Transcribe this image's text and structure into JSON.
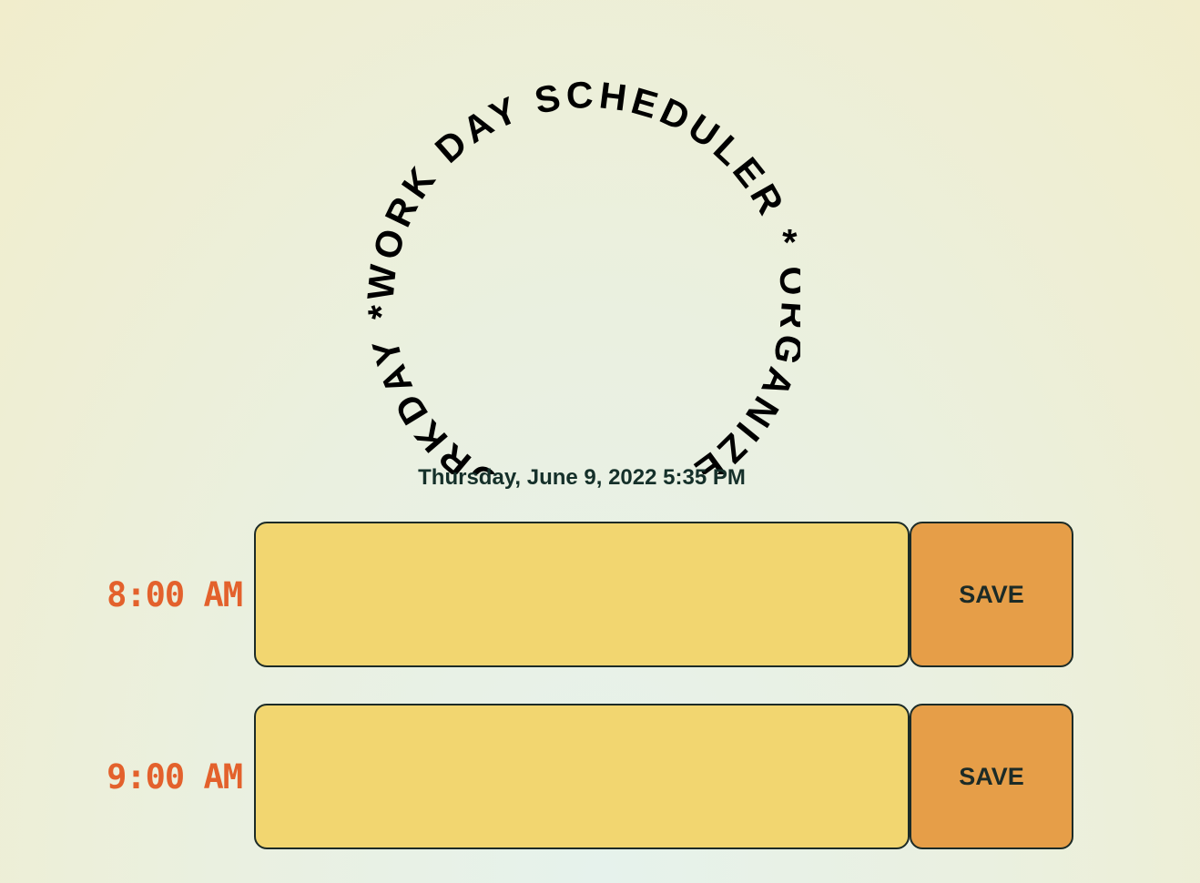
{
  "header": {
    "circular_title": "WORK DAY SCHEDULER * ORGANIZE YOUR WORKDAY * ",
    "current_datetime": "Thursday, June 9, 2022 5:35 PM"
  },
  "time_blocks": [
    {
      "hour_label": "8:00 AM",
      "task_value": "",
      "save_label": "SAVE"
    },
    {
      "hour_label": "9:00 AM",
      "task_value": "",
      "save_label": "SAVE"
    }
  ],
  "colors": {
    "hour_text": "#e3612c",
    "task_bg": "#f2d670",
    "save_bg": "#e69e48",
    "border": "#1c2b27"
  }
}
